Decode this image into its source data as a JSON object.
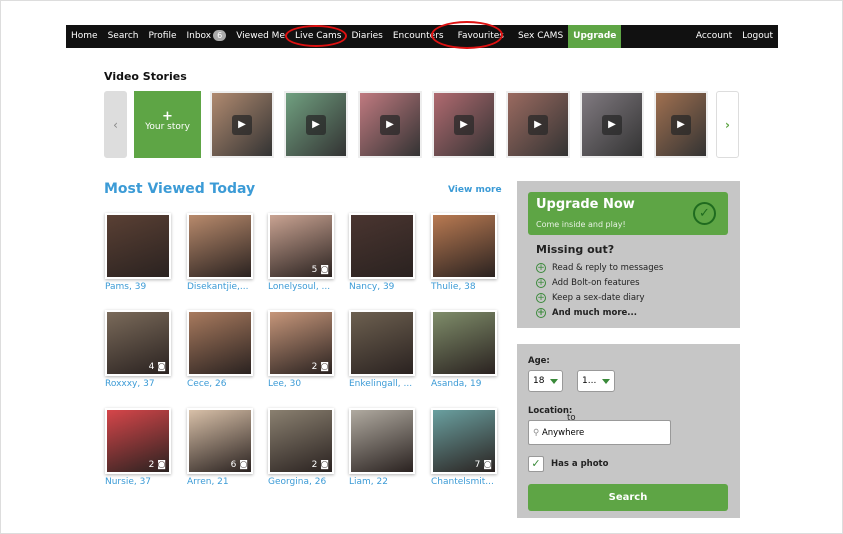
{
  "nav": {
    "items": [
      "Home",
      "Search",
      "Profile",
      "Inbox",
      "Viewed Me",
      "Live Cams",
      "Diaries",
      "Encounters",
      "Favourites",
      "Sex CAMS"
    ],
    "inbox_count": "6",
    "upgrade": "Upgrade",
    "account": "Account",
    "logout": "Logout"
  },
  "stories": {
    "title": "Video Stories",
    "your_story": "Your story",
    "plus": "+",
    "prev": "‹",
    "next": "›"
  },
  "most_viewed": {
    "title": "Most Viewed Today",
    "view_more": "View more",
    "profiles": [
      {
        "name": "Pams, 39",
        "photos": "",
        "color": "#5a4034"
      },
      {
        "name": "Disekantjie,...",
        "photos": "",
        "color": "#b88a6c"
      },
      {
        "name": "Lonelysoul, ...",
        "photos": "5",
        "color": "#c9a392"
      },
      {
        "name": "Nancy, 39",
        "photos": "",
        "color": "#4a3530"
      },
      {
        "name": "Thulie, 38",
        "photos": "",
        "color": "#b97a52"
      },
      {
        "name": "Roxxxy, 37",
        "photos": "4",
        "color": "#7a6a5a"
      },
      {
        "name": "Cece, 26",
        "photos": "",
        "color": "#a87a5e"
      },
      {
        "name": "Lee, 30",
        "photos": "2",
        "color": "#c6967a"
      },
      {
        "name": "Enkelingall, ...",
        "photos": "",
        "color": "#6d6050"
      },
      {
        "name": "Asanda, 19",
        "photos": "",
        "color": "#7f8d6a"
      },
      {
        "name": "Nursie, 37",
        "photos": "2",
        "color": "#d6464a"
      },
      {
        "name": "Arren, 21",
        "photos": "6",
        "color": "#d8c0a8"
      },
      {
        "name": "Georgina, 26",
        "photos": "2",
        "color": "#8a8070"
      },
      {
        "name": "Liam, 22",
        "photos": "",
        "color": "#b0aaa0"
      },
      {
        "name": "Chantelsmit...",
        "photos": "7",
        "color": "#6aa0a0"
      }
    ]
  },
  "upgrade_panel": {
    "title": "Upgrade Now",
    "subtitle": "Come inside and play!",
    "missing": "Missing out?",
    "features": [
      "Read & reply to messages",
      "Add Bolt-on features",
      "Keep a sex-date diary",
      "And much more..."
    ]
  },
  "search": {
    "age_label": "Age:",
    "age_from": "18",
    "to": "to",
    "age_to": "1...",
    "location_label": "Location:",
    "location_value": "Anywhere",
    "has_photo": "Has a photo",
    "button": "Search"
  },
  "colors": {
    "accent": "#5ea545",
    "link": "#3c9bd6",
    "panel": "#c6c6c6"
  }
}
